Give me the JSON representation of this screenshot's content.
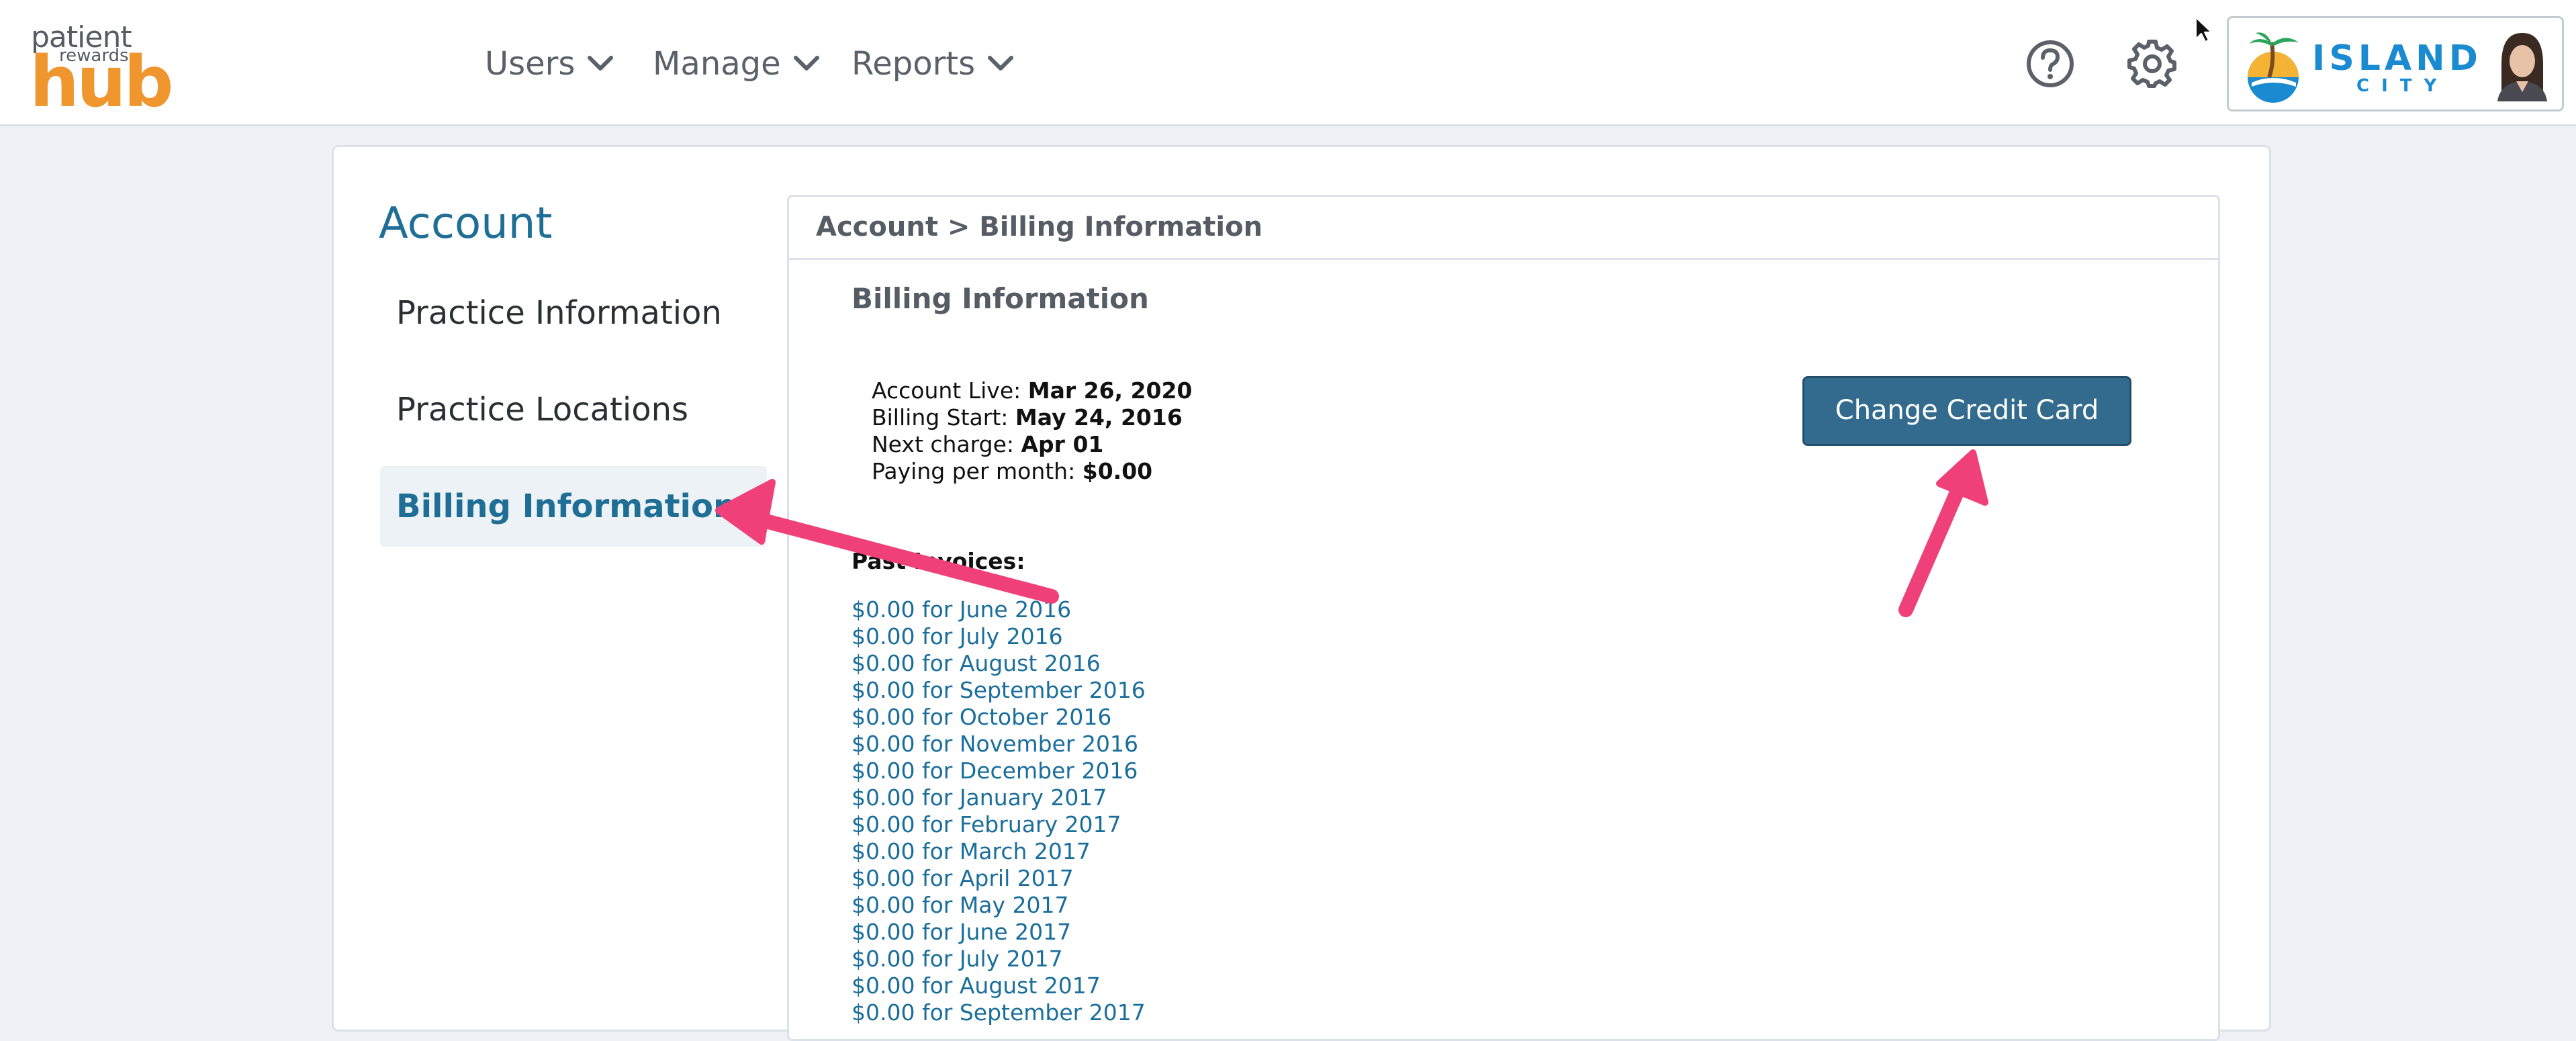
{
  "logo": {
    "line1": "patient",
    "line2": "rewards",
    "line3": "hub"
  },
  "nav": [
    {
      "label": "Users"
    },
    {
      "label": "Manage"
    },
    {
      "label": "Reports"
    }
  ],
  "header_icons": [
    "help-icon",
    "gear-icon"
  ],
  "brand": {
    "word1": "ISLAND",
    "word2": "CITY"
  },
  "sidebar": {
    "title": "Account",
    "items": [
      {
        "label": "Practice Information"
      },
      {
        "label": "Practice Locations"
      },
      {
        "label": "Billing Information",
        "active": true
      }
    ]
  },
  "main": {
    "breadcrumb": "Account > Billing Information",
    "section_title": "Billing Information",
    "info": [
      {
        "label": "Account Live:",
        "value": "Mar 26, 2020"
      },
      {
        "label": "Billing Start:",
        "value": "May 24, 2016"
      },
      {
        "label": "Next charge:",
        "value": "Apr 01"
      },
      {
        "label": "Paying per month:",
        "value": "$0.00"
      }
    ],
    "change_card_label": "Change Credit Card",
    "past_invoices_label": "Past Invoices:",
    "invoices": [
      "$0.00 for June 2016",
      "$0.00 for July 2016",
      "$0.00 for August 2016",
      "$0.00 for September 2016",
      "$0.00 for October 2016",
      "$0.00 for November 2016",
      "$0.00 for December 2016",
      "$0.00 for January 2017",
      "$0.00 for February 2017",
      "$0.00 for March 2017",
      "$0.00 for April 2017",
      "$0.00 for May 2017",
      "$0.00 for June 2017",
      "$0.00 for July 2017",
      "$0.00 for August 2017",
      "$0.00 for September 2017"
    ]
  },
  "colors": {
    "accent": "#1e6e96",
    "button": "#336b8e",
    "logo_orange": "#f0962e",
    "annotation": "#f0407a",
    "link": "#1a6e9b"
  }
}
